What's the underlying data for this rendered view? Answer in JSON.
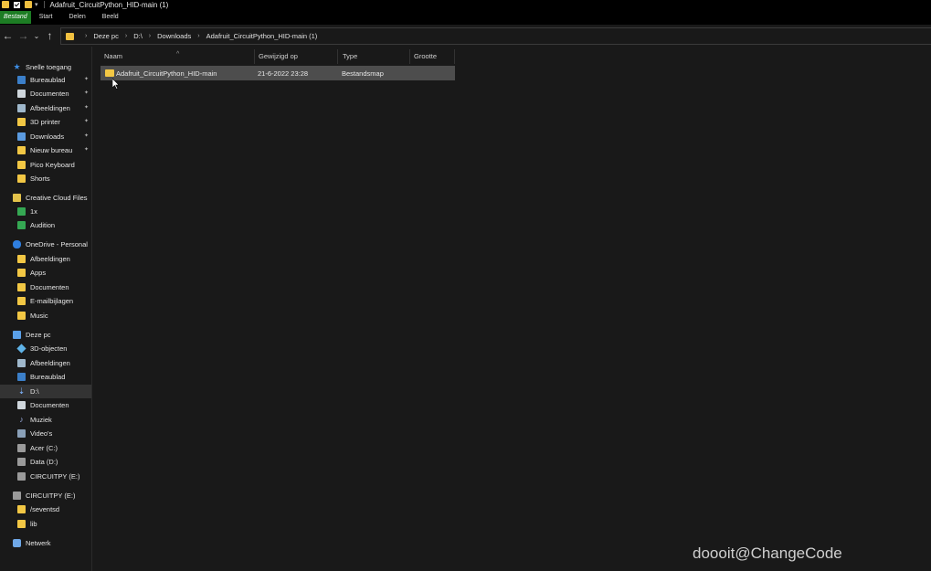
{
  "window": {
    "title": "Adafruit_CircuitPython_HID-main (1)"
  },
  "ribbon": {
    "tabs": [
      "Bestand",
      "Start",
      "Delen",
      "Beeld"
    ]
  },
  "address": {
    "crumbs": [
      "Deze pc",
      "D:\\",
      "Downloads",
      "Adafruit_CircuitPython_HID-main (1)"
    ]
  },
  "sidebar": {
    "quick_access": "Snelle toegang",
    "quick_items": [
      "Bureaublad",
      "Documenten",
      "Afbeeldingen",
      "3D printer",
      "Downloads",
      "Nieuw bureau",
      "Pico Keyboard",
      "Shorts"
    ],
    "creative_cloud": "Creative Cloud Files",
    "cc_items": [
      "1x",
      "Audition"
    ],
    "onedrive": "OneDrive - Personal",
    "onedrive_items": [
      "Afbeeldingen",
      "Apps",
      "Documenten",
      "E-mailbijlagen",
      "Music"
    ],
    "this_pc": "Deze pc",
    "pc_items": [
      "3D-objecten",
      "Afbeeldingen",
      "Bureaublad",
      "D:\\",
      "Documenten",
      "Muziek",
      "Video's",
      "Acer (C:)",
      "Data (D:)",
      "CIRCUITPY (E:)"
    ],
    "circuitpy": "CIRCUITPY (E:)",
    "circuitpy_items": [
      "/seventsd",
      "lib"
    ],
    "network": "Netwerk"
  },
  "columns": {
    "name": "Naam",
    "modified": "Gewijzigd op",
    "type": "Type",
    "size": "Grootte"
  },
  "files": [
    {
      "name": "Adafruit_CircuitPython_HID-main",
      "modified": "21-6-2022 23:28",
      "type": "Bestandsmap",
      "size": ""
    }
  ],
  "watermark": "doooit@ChangeCode",
  "colors": {
    "accent": "#1d7d24",
    "folder": "#f2c744",
    "background": "#191919"
  }
}
